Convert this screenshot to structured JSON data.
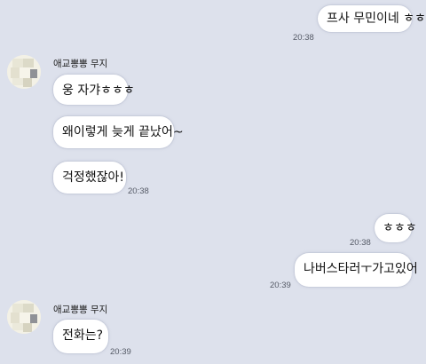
{
  "messages": {
    "m1": {
      "text": "프사 무민이네 ㅎㅎ",
      "time": "20:38"
    },
    "sender1": "애교뽕뽕 무지",
    "m2": {
      "text": "웅 자갸ㅎㅎㅎ"
    },
    "m3": {
      "text": "왜이렇게 늦게 끝났어~"
    },
    "m4": {
      "text": "걱정했잖아!",
      "time": "20:38"
    },
    "m5": {
      "text": "ㅎㅎㅎ",
      "time": "20:38"
    },
    "m6": {
      "text": "나버스타러ㅜ가고있어",
      "time": "20:39"
    },
    "sender2": "애교뽕뽕 무지",
    "m7": {
      "text": "전화는?",
      "time": "20:39"
    }
  },
  "colors": {
    "background": "#dde1ec",
    "bubble": "#ffffff"
  }
}
